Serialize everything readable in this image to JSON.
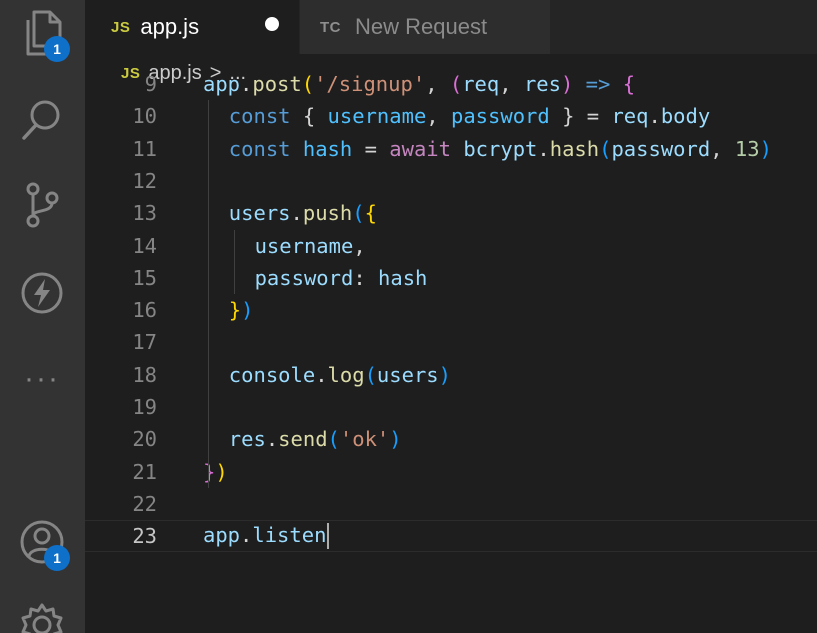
{
  "activity_bar": {
    "explorer_badge": "1",
    "accounts_badge": "1",
    "more_label": "···"
  },
  "tabs": [
    {
      "icon_text": "JS",
      "label": "app.js",
      "active": true,
      "dirty": true
    },
    {
      "icon_text": "TC",
      "label": "New Request",
      "active": false
    }
  ],
  "breadcrumb": {
    "icon_text": "JS",
    "file": "app.js",
    "separator": ">",
    "rest": "..."
  },
  "editor": {
    "current_line": "23",
    "lines": [
      {
        "num": "9",
        "tokens": [
          {
            "t": "app",
            "c": "var"
          },
          {
            "t": ".",
            "c": "op"
          },
          {
            "t": "post",
            "c": "fn"
          },
          {
            "t": "(",
            "c": "b1"
          },
          {
            "t": "'/signup'",
            "c": "str"
          },
          {
            "t": ", ",
            "c": "op"
          },
          {
            "t": "(",
            "c": "b2"
          },
          {
            "t": "req",
            "c": "var"
          },
          {
            "t": ", ",
            "c": "op"
          },
          {
            "t": "res",
            "c": "var"
          },
          {
            "t": ")",
            "c": "b2"
          },
          {
            "t": " => ",
            "c": "kw"
          },
          {
            "t": "{",
            "c": "b2"
          }
        ]
      },
      {
        "num": "10",
        "tokens": [
          {
            "t": "const",
            "c": "kw"
          },
          {
            "t": " { ",
            "c": "op"
          },
          {
            "t": "username",
            "c": "var2"
          },
          {
            "t": ", ",
            "c": "op"
          },
          {
            "t": "password",
            "c": "var2"
          },
          {
            "t": " } = ",
            "c": "op"
          },
          {
            "t": "req",
            "c": "var"
          },
          {
            "t": ".",
            "c": "op"
          },
          {
            "t": "body",
            "c": "var"
          }
        ]
      },
      {
        "num": "11",
        "tokens": [
          {
            "t": "const",
            "c": "kw"
          },
          {
            "t": " ",
            "c": "op"
          },
          {
            "t": "hash",
            "c": "var2"
          },
          {
            "t": " = ",
            "c": "op"
          },
          {
            "t": "await",
            "c": "ctl"
          },
          {
            "t": " ",
            "c": "op"
          },
          {
            "t": "bcrypt",
            "c": "var"
          },
          {
            "t": ".",
            "c": "op"
          },
          {
            "t": "hash",
            "c": "fn"
          },
          {
            "t": "(",
            "c": "b3"
          },
          {
            "t": "password",
            "c": "var"
          },
          {
            "t": ", ",
            "c": "op"
          },
          {
            "t": "13",
            "c": "num"
          },
          {
            "t": ")",
            "c": "b3"
          }
        ]
      },
      {
        "num": "12",
        "tokens": []
      },
      {
        "num": "13",
        "tokens": [
          {
            "t": "users",
            "c": "var"
          },
          {
            "t": ".",
            "c": "op"
          },
          {
            "t": "push",
            "c": "fn"
          },
          {
            "t": "(",
            "c": "b3"
          },
          {
            "t": "{",
            "c": "b1"
          }
        ]
      },
      {
        "num": "14",
        "tokens": [
          {
            "t": "username",
            "c": "var"
          },
          {
            "t": ",",
            "c": "op"
          }
        ]
      },
      {
        "num": "15",
        "tokens": [
          {
            "t": "password",
            "c": "var"
          },
          {
            "t": ": ",
            "c": "op"
          },
          {
            "t": "hash",
            "c": "var"
          }
        ]
      },
      {
        "num": "16",
        "tokens": [
          {
            "t": "}",
            "c": "b1"
          },
          {
            "t": ")",
            "c": "b3"
          }
        ]
      },
      {
        "num": "17",
        "tokens": []
      },
      {
        "num": "18",
        "tokens": [
          {
            "t": "console",
            "c": "var"
          },
          {
            "t": ".",
            "c": "op"
          },
          {
            "t": "log",
            "c": "fn"
          },
          {
            "t": "(",
            "c": "b3"
          },
          {
            "t": "users",
            "c": "var"
          },
          {
            "t": ")",
            "c": "b3"
          }
        ]
      },
      {
        "num": "19",
        "tokens": []
      },
      {
        "num": "20",
        "tokens": [
          {
            "t": "res",
            "c": "var"
          },
          {
            "t": ".",
            "c": "op"
          },
          {
            "t": "send",
            "c": "fn"
          },
          {
            "t": "(",
            "c": "b3"
          },
          {
            "t": "'ok'",
            "c": "str"
          },
          {
            "t": ")",
            "c": "b3"
          }
        ]
      },
      {
        "num": "21",
        "tokens": [
          {
            "t": "}",
            "c": "b2"
          },
          {
            "t": ")",
            "c": "b1"
          }
        ]
      },
      {
        "num": "22",
        "tokens": []
      },
      {
        "num": "23",
        "tokens": [
          {
            "t": "app",
            "c": "var"
          },
          {
            "t": ".",
            "c": "op"
          },
          {
            "t": "listen",
            "c": "var"
          }
        ]
      }
    ]
  },
  "colors": {
    "keyword": "#569cd6",
    "variable": "#9cdcfe",
    "function": "#dcdcaa",
    "string": "#ce9178",
    "number": "#b5cea8",
    "accent_badge": "#0e70c9"
  }
}
